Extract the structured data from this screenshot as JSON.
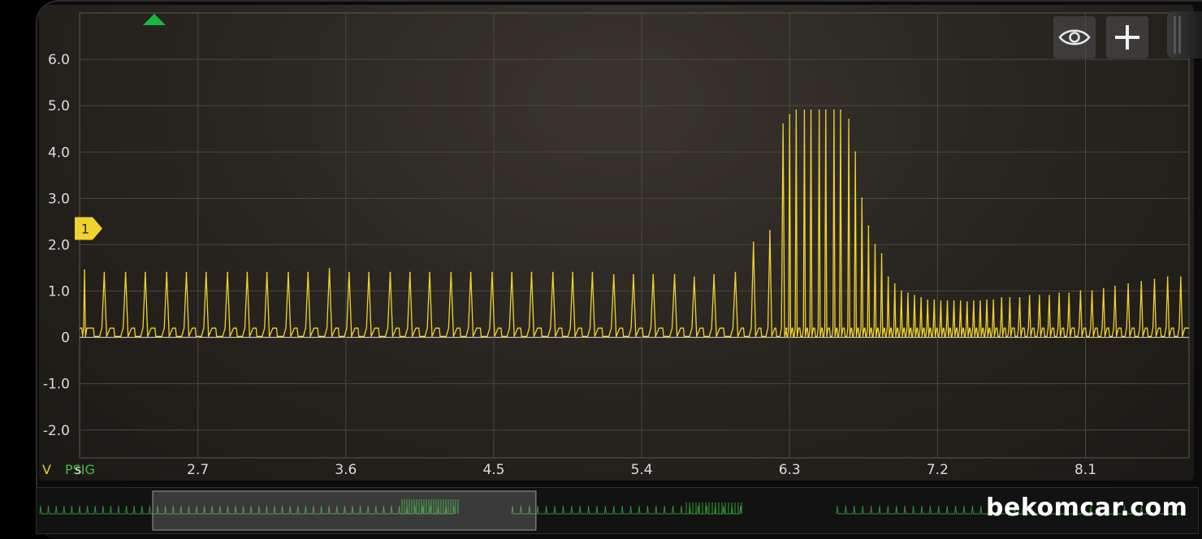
{
  "toolbar": {
    "eye_icon": "eye-icon",
    "add_icon": "plus-icon"
  },
  "channel": {
    "marker_label": "1",
    "unit": "V",
    "name": "PSIG",
    "x_unit": "s",
    "color": "#f1d130",
    "name_color": "#3fbf3f",
    "unit_color": "#e8c830"
  },
  "trigger_marker_color": "#18b83c",
  "watermark": "bekomcar.com",
  "chart_data": {
    "type": "line",
    "title": "",
    "xlabel": "s",
    "ylabel": "V",
    "xlim": [
      1.98,
      8.73
    ],
    "ylim": [
      -2.6,
      7.0
    ],
    "x_ticks": [
      "2.7",
      "3.6",
      "4.5",
      "5.4",
      "6.3",
      "7.2",
      "8.1"
    ],
    "y_ticks": [
      "6.0",
      "5.0",
      "4.0",
      "3.0",
      "2.0",
      "1.0",
      "0",
      "-1.0",
      "-2.0"
    ],
    "grid": true,
    "series": [
      {
        "name": "PSIG",
        "baseline": 0.2,
        "pulses": [
          {
            "x": 2.01,
            "peak": 1.45
          },
          {
            "x": 2.13,
            "peak": 1.4
          },
          {
            "x": 2.26,
            "peak": 1.4
          },
          {
            "x": 2.38,
            "peak": 1.4
          },
          {
            "x": 2.51,
            "peak": 1.4
          },
          {
            "x": 2.63,
            "peak": 1.4
          },
          {
            "x": 2.75,
            "peak": 1.4
          },
          {
            "x": 2.88,
            "peak": 1.4
          },
          {
            "x": 3.0,
            "peak": 1.4
          },
          {
            "x": 3.12,
            "peak": 1.4
          },
          {
            "x": 3.25,
            "peak": 1.4
          },
          {
            "x": 3.37,
            "peak": 1.4
          },
          {
            "x": 3.5,
            "peak": 1.48
          },
          {
            "x": 3.62,
            "peak": 1.4
          },
          {
            "x": 3.74,
            "peak": 1.4
          },
          {
            "x": 3.87,
            "peak": 1.4
          },
          {
            "x": 3.99,
            "peak": 1.4
          },
          {
            "x": 4.11,
            "peak": 1.4
          },
          {
            "x": 4.24,
            "peak": 1.4
          },
          {
            "x": 4.36,
            "peak": 1.4
          },
          {
            "x": 4.49,
            "peak": 1.4
          },
          {
            "x": 4.61,
            "peak": 1.4
          },
          {
            "x": 4.73,
            "peak": 1.4
          },
          {
            "x": 4.86,
            "peak": 1.4
          },
          {
            "x": 4.98,
            "peak": 1.4
          },
          {
            "x": 5.1,
            "peak": 1.4
          },
          {
            "x": 5.23,
            "peak": 1.35
          },
          {
            "x": 5.35,
            "peak": 1.35
          },
          {
            "x": 5.47,
            "peak": 1.35
          },
          {
            "x": 5.6,
            "peak": 1.35
          },
          {
            "x": 5.72,
            "peak": 1.3
          },
          {
            "x": 5.84,
            "peak": 1.35
          },
          {
            "x": 5.97,
            "peak": 1.4
          },
          {
            "x": 6.08,
            "peak": 2.05
          },
          {
            "x": 6.18,
            "peak": 2.3
          },
          {
            "x": 6.26,
            "peak": 4.6
          },
          {
            "x": 6.3,
            "peak": 4.8
          },
          {
            "x": 6.34,
            "peak": 4.9
          },
          {
            "x": 6.39,
            "peak": 4.9
          },
          {
            "x": 6.43,
            "peak": 4.9
          },
          {
            "x": 6.48,
            "peak": 4.9
          },
          {
            "x": 6.52,
            "peak": 4.9
          },
          {
            "x": 6.57,
            "peak": 4.9
          },
          {
            "x": 6.61,
            "peak": 4.9
          },
          {
            "x": 6.66,
            "peak": 4.7
          },
          {
            "x": 6.7,
            "peak": 4.0
          },
          {
            "x": 6.74,
            "peak": 3.0
          },
          {
            "x": 6.78,
            "peak": 2.4
          },
          {
            "x": 6.82,
            "peak": 2.0
          },
          {
            "x": 6.86,
            "peak": 1.8
          },
          {
            "x": 6.9,
            "peak": 1.3
          },
          {
            "x": 6.94,
            "peak": 1.15
          },
          {
            "x": 6.98,
            "peak": 1.0
          },
          {
            "x": 7.02,
            "peak": 0.95
          },
          {
            "x": 7.06,
            "peak": 0.9
          },
          {
            "x": 7.1,
            "peak": 0.85
          },
          {
            "x": 7.14,
            "peak": 0.8
          },
          {
            "x": 7.18,
            "peak": 0.8
          },
          {
            "x": 7.22,
            "peak": 0.78
          },
          {
            "x": 7.26,
            "peak": 0.78
          },
          {
            "x": 7.3,
            "peak": 0.78
          },
          {
            "x": 7.34,
            "peak": 0.78
          },
          {
            "x": 7.38,
            "peak": 0.76
          },
          {
            "x": 7.42,
            "peak": 0.78
          },
          {
            "x": 7.46,
            "peak": 0.78
          },
          {
            "x": 7.5,
            "peak": 0.8
          },
          {
            "x": 7.54,
            "peak": 0.8
          },
          {
            "x": 7.59,
            "peak": 0.85
          },
          {
            "x": 7.64,
            "peak": 0.85
          },
          {
            "x": 7.7,
            "peak": 0.85
          },
          {
            "x": 7.76,
            "peak": 0.9
          },
          {
            "x": 7.82,
            "peak": 0.9
          },
          {
            "x": 7.88,
            "peak": 0.9
          },
          {
            "x": 7.94,
            "peak": 0.95
          },
          {
            "x": 8.0,
            "peak": 0.95
          },
          {
            "x": 8.07,
            "peak": 1.0
          },
          {
            "x": 8.14,
            "peak": 1.0
          },
          {
            "x": 8.21,
            "peak": 1.05
          },
          {
            "x": 8.28,
            "peak": 1.1
          },
          {
            "x": 8.36,
            "peak": 1.15
          },
          {
            "x": 8.44,
            "peak": 1.2
          },
          {
            "x": 8.52,
            "peak": 1.25
          },
          {
            "x": 8.6,
            "peak": 1.3
          },
          {
            "x": 8.68,
            "peak": 1.3
          }
        ]
      }
    ]
  },
  "overview": {
    "window_start_fraction": 0.1,
    "window_end_fraction": 0.43
  }
}
